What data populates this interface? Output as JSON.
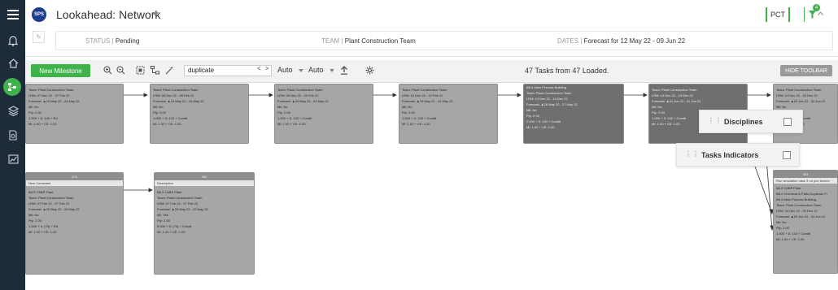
{
  "header": {
    "logo_text": "SPS",
    "title": "Lookahead: Network",
    "pct_label": "PCT",
    "filter_count": "4"
  },
  "info": {
    "status_label": "STATUS",
    "status_value": "Pending",
    "team_label": "TEAM",
    "team_value": "Plant Construction Team",
    "dates_label": "DATES",
    "dates_value": "Forecast for 12 May 22 - 09 Jun 22"
  },
  "toolbar": {
    "new_milestone": "New Milestone",
    "search_value": "duplicate",
    "nav_prev": "<",
    "nav_next": ">",
    "select1": "Auto",
    "select2": "Auto",
    "status_text": "47 Tasks from 47 Loaded.",
    "hide_toolbar": "HIDE TOOLBAR"
  },
  "popups": {
    "disciplines": "Disciplines",
    "tasks_indicators": "Tasks Indicators"
  },
  "cards": {
    "c1": [
      "Team: Plant Construction Team",
      "LRM: 07 Dec 22 - 07 Feb 22",
      "Forecast: ▲24 May 22 - 24 May 22",
      "Mil: No",
      "Pty: 2.00",
      "1.000 + ß: 143 + Rd",
      "MI: 1.00 + CE: 1.00"
    ],
    "c2": [
      "Team: Plant Construction Team",
      "LRM: 08 Dec 22 - 08 Feb 22",
      "Forecast: ▲24 May 22 - 24 May 22",
      "Mil: No",
      "Pty: 2.00",
      "1.000 + ß: 143 + Condit",
      "MI: 1.00 + CE: 1.00"
    ],
    "c3": [
      "Team: Plant Construction Team",
      "LRM: 09 Dec 22 - 09 Feb 22",
      "Forecast: ▲24 May 22 - 24 May 22",
      "Mil: No",
      "Pty: 2.00",
      "1.000 + ß: 143 + Condit",
      "MI: 1.00 + CE: 1.00"
    ],
    "c4": [
      "Team: Plant Construction Team",
      "LRM: 10 Dec 22 - 10 Feb 22",
      "Forecast: ▲24 May 22 - 24 May 22",
      "Mil: No",
      "Pty: 2.00",
      "1.000 + ß: 143 + Condit",
      "MI: 1.00 + CE: 1.00"
    ],
    "c5": [
      "B8.4 Main Process Building",
      "Team: Plant Construction Team",
      "LRM: 13 Dec 22 - 14 Dec 22",
      "Forecast: ▲26 May 22 - 27 May 22",
      "Mil: No",
      "Pty: 2.00",
      "2.000 + ß: 143 + Condit",
      "MI: 1.00 + CE: 1.00"
    ],
    "c6": [
      "Team: Plant Construction Team",
      "LRM: 13 Dec 22 - 15 Dec 22",
      "Forecast: ▲01 Jun 22 - 01 Jun 22",
      "Mil: No",
      "Pty: 2.00",
      "1.000 + ß: 143 + Condit",
      "MI: 1.00 + CE: 1.00"
    ],
    "c7": [
      "Team: Plant Construction Team",
      "LRM: 14 Dec 22 - 16 Dec 22",
      "Forecast: ▲02 Jun 22 - 02 Jun 22",
      "Mil: No",
      "Pty: 2.00",
      "1.000 + ß: 143 + Condit",
      "MI: 1.00 + CE: 1.00"
    ],
    "c8_hdr": "473",
    "c8_band": "New Constraint",
    "c8": [
      "B8.3 CABP Plant",
      "Team: Plant Construction Team",
      "LRM: 07 Feb 22 - 07 Feb 22",
      "Forecast: ▲20 May 22 - 20 May 22",
      "Mil: No",
      "Pty: 2.00",
      "1.000 + ß: (74) + Rd",
      "MI: 1.00 + CE: 1.00"
    ],
    "c9_hdr": "380",
    "c9_band": "Description",
    "c9": [
      "B8.3 CABP Plant",
      "Team: Plant Construction Team",
      "LRM: 07 Feb 22 - 07 Feb 22",
      "Forecast: ▲20 May 22 - 20 May 22",
      "Mil: Yes",
      "Pty: 2.00",
      "0.000 + ß: (74) + Condit",
      "MI: 1.00 + CE: 1.00"
    ],
    "c10_hdr": "383",
    "c10_band": "Run simulation case 3 on pco techno",
    "c10": [
      "B8.3 CABP Plant",
      "B8.4 Chemical & Parts Duplicate Fi",
      "B8.4 Main Process Building",
      "Team: Plant Construction Team",
      "LRM: 20 Dec 22 - 20 Dec 22",
      "Forecast: ▲03 Jun 22 - 03 Jun 22",
      "Mil: No",
      "Pty: 2.00",
      "1.000 + ß: 143 + Condit",
      "MI: 1.00 + CE: 1.00"
    ]
  }
}
